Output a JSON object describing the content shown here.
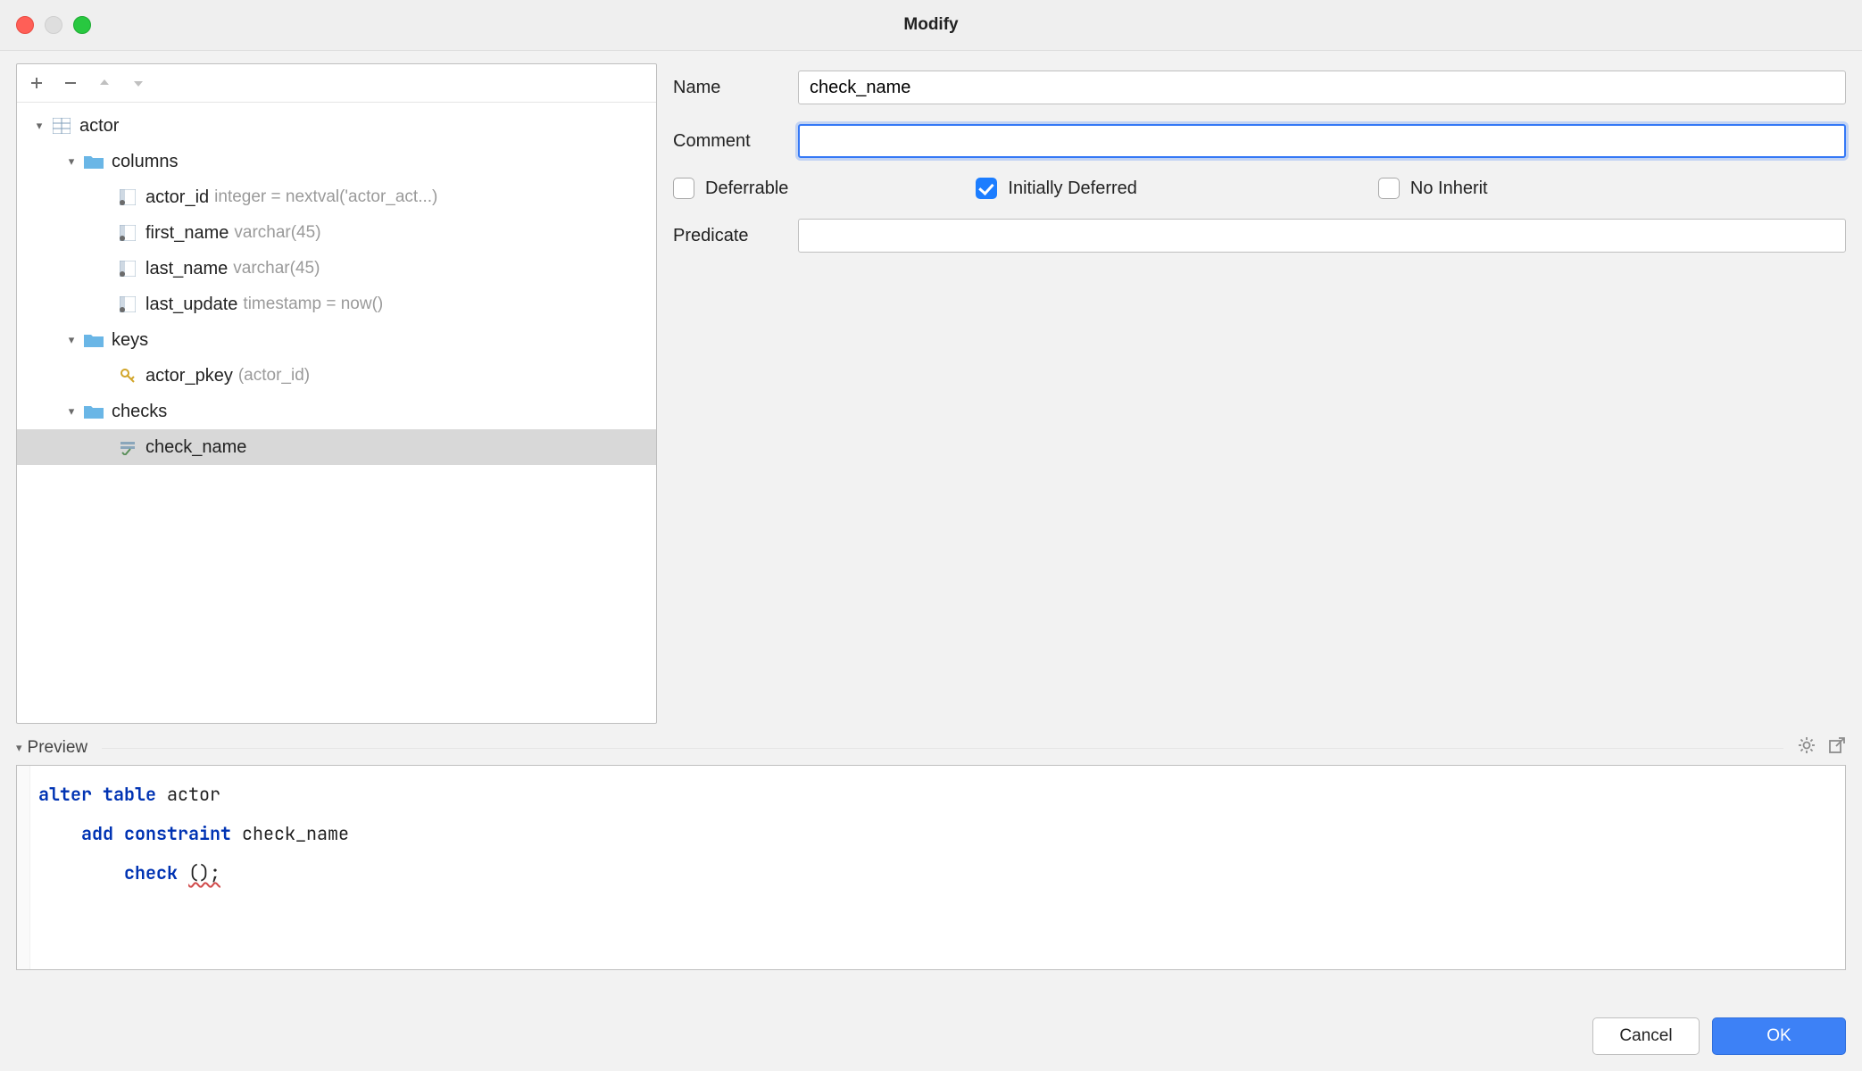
{
  "window": {
    "title": "Modify"
  },
  "tree": {
    "root": {
      "name": "actor"
    },
    "groups": {
      "columns": {
        "label": "columns",
        "items": [
          {
            "name": "actor_id",
            "type": "integer = nextval('actor_act...)"
          },
          {
            "name": "first_name",
            "type": "varchar(45)"
          },
          {
            "name": "last_name",
            "type": "varchar(45)"
          },
          {
            "name": "last_update",
            "type": "timestamp = now()"
          }
        ]
      },
      "keys": {
        "label": "keys",
        "items": [
          {
            "name": "actor_pkey",
            "type": "(actor_id)"
          }
        ]
      },
      "checks": {
        "label": "checks",
        "items": [
          {
            "name": "check_name"
          }
        ]
      }
    }
  },
  "form": {
    "labels": {
      "name": "Name",
      "comment": "Comment",
      "predicate": "Predicate",
      "deferrable": "Deferrable",
      "initially_deferred": "Initially Deferred",
      "no_inherit": "No Inherit"
    },
    "values": {
      "name": "check_name",
      "comment": "",
      "predicate": "",
      "deferrable": false,
      "initially_deferred": true,
      "no_inherit": false
    }
  },
  "preview": {
    "header": "Preview",
    "sql": {
      "line1_kw1": "alter",
      "line1_kw2": "table",
      "line1_ident": "actor",
      "line2_kw1": "add",
      "line2_kw2": "constraint",
      "line2_ident": "check_name",
      "line3_kw": "check",
      "line3_paren": "();"
    }
  },
  "buttons": {
    "cancel": "Cancel",
    "ok": "OK"
  }
}
